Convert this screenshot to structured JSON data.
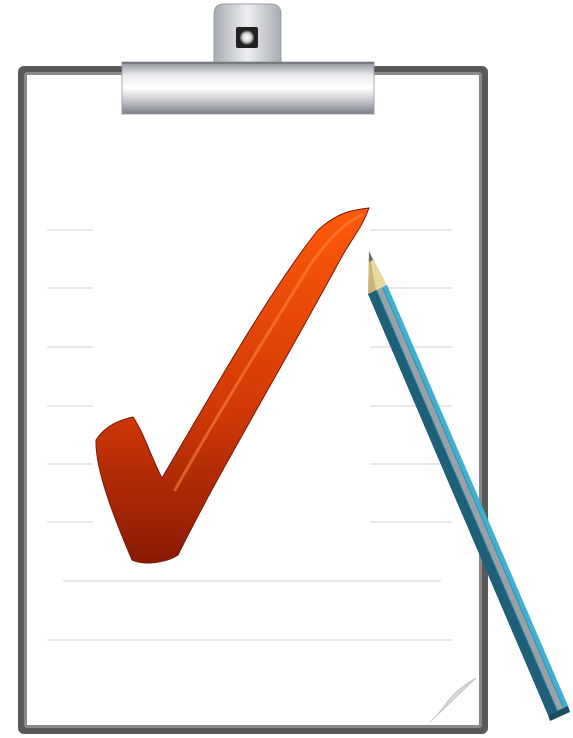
{
  "illustration": {
    "subject": "",
    "icons": [
      "clipboard-icon",
      "clip-icon",
      "checkmark-icon",
      "pencil-icon",
      "page-curl-icon"
    ],
    "colors": {
      "board_frame": "#555555",
      "paper": "#ffffff",
      "rule_line": "#d9d9d9",
      "clip_metal_light": "#e8e8ee",
      "clip_metal_dark": "#7d8088",
      "checkmark_top": "#ff5a0a",
      "checkmark_bottom": "#8a1a06",
      "pencil_body": "#2a8fb0",
      "pencil_dark": "#1f5f77",
      "pencil_stripe": "#9aa2a8",
      "pencil_wood": "#e8d9a0",
      "page_curl": "#d4d4d4"
    }
  }
}
